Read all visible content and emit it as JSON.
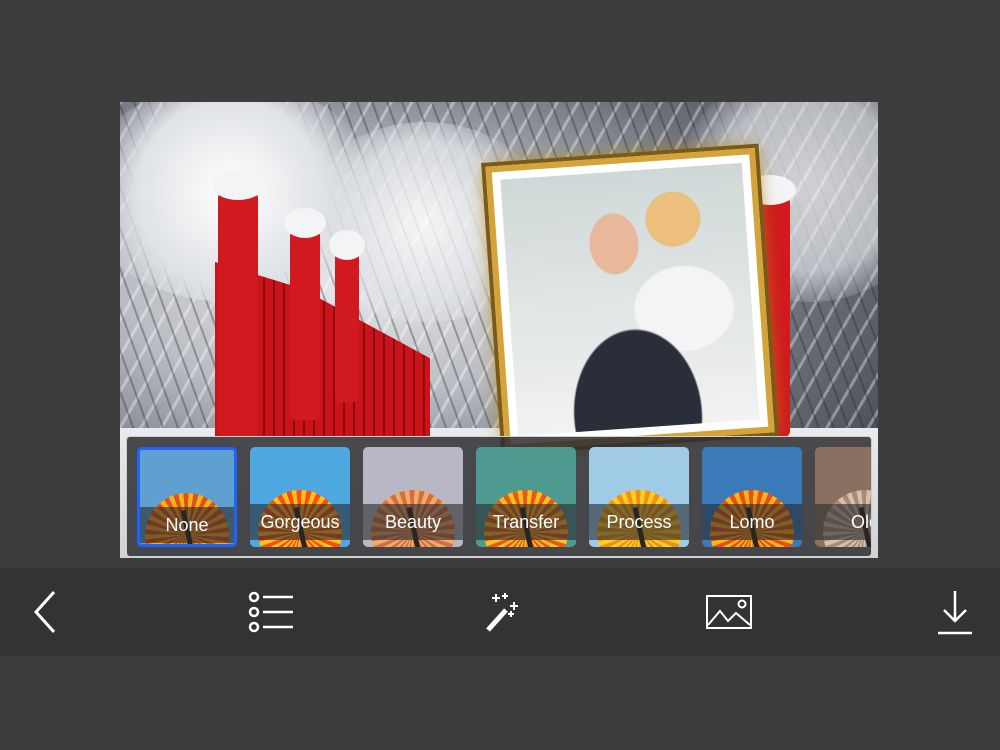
{
  "filters": [
    {
      "label": "None",
      "selected": true,
      "bg": "#5fa0d0",
      "p1": "#f2b21c",
      "p2": "#e0501a"
    },
    {
      "label": "Gorgeous",
      "selected": false,
      "bg": "#4fa8e0",
      "p1": "#ffc21a",
      "p2": "#ff4a10"
    },
    {
      "label": "Beauty",
      "selected": false,
      "bg": "#b8b8c4",
      "p1": "#eab060",
      "p2": "#d86a4a"
    },
    {
      "label": "Transfer",
      "selected": false,
      "bg": "#4f9a90",
      "p1": "#f6c020",
      "p2": "#e85818"
    },
    {
      "label": "Process",
      "selected": false,
      "bg": "#9fcbe6",
      "p1": "#ffd020",
      "p2": "#f0901a"
    },
    {
      "label": "Lomo",
      "selected": false,
      "bg": "#3a7ab8",
      "p1": "#f8b418",
      "p2": "#e45016"
    },
    {
      "label": "Old",
      "selected": false,
      "bg": "#8a7060",
      "p1": "#d8c0a8",
      "p2": "#a88a78"
    }
  ],
  "toolbar": {
    "back": "back",
    "frames": "frames-list",
    "effects": "magic-wand",
    "background": "image",
    "save": "download"
  }
}
